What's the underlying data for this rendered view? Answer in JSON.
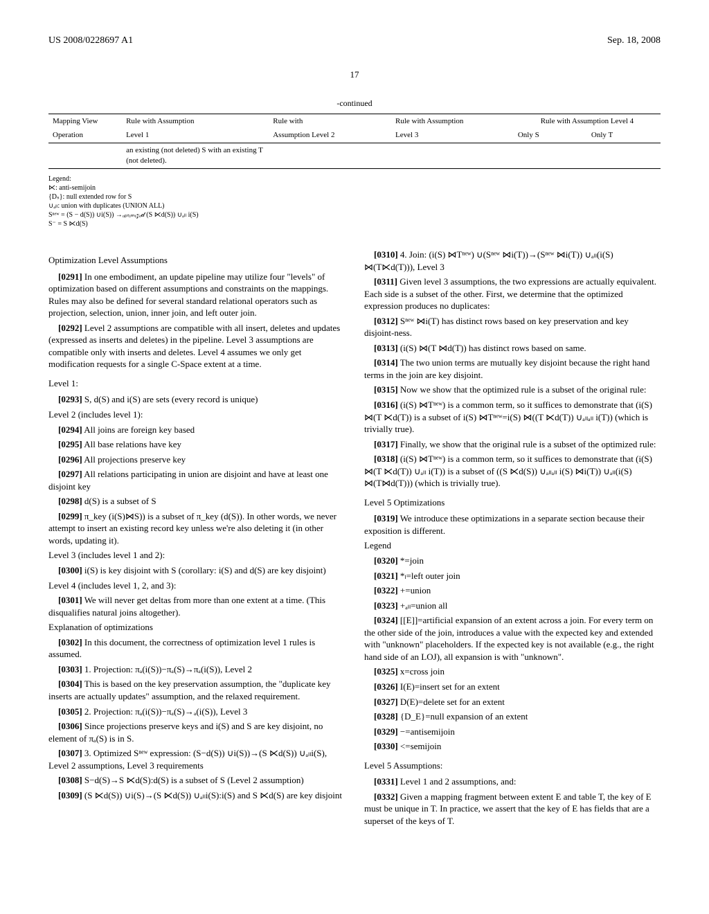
{
  "header": {
    "pub_no": "US 2008/0228697 A1",
    "date": "Sep. 18, 2008"
  },
  "page_number": "17",
  "table": {
    "caption": "-continued",
    "h_mapping_view": "Mapping View",
    "h_rule_assumption": "Rule with Assumption",
    "h_rule_with": "Rule with",
    "h_rule_assumption2": "Rule with Assumption",
    "h_rule_assumption_level4": "Rule with Assumption Level 4",
    "h_operation": "Operation",
    "h_level1": "Level 1",
    "h_assumption_level2": "Assumption Level 2",
    "h_level3": "Level 3",
    "h_only_s": "Only S",
    "h_only_t": "Only T",
    "cell_text": "an existing (not deleted) S with an existing T (not deleted)."
  },
  "legend": {
    "title": "Legend:",
    "l1": "⋉: anti-semijoin",
    "l2": "{Dₛ}: null extended row for S",
    "l3": "∪ₐₗₗ: union with duplicates (UNION ALL)",
    "l4": "Sⁿᵉʷ = (S − d(S)) ∪i(S)) →ₒₚₜᵢₘᵢ𝓏ₑ𝒹 (S ⋉d(S)) ∪ₐₗₗ i(S)",
    "l5": "S⁻ = S ⋉d(S)"
  },
  "left": {
    "opt_title": "Optimization Level Assumptions",
    "p0291n": "[0291]",
    "p0291": "In one embodiment, an update pipeline may utilize four \"levels\" of optimization based on different assumptions and constraints on the mappings. Rules may also be defined for several standard relational operators such as projection, selection, union, inner join, and left outer join.",
    "p0292n": "[0292]",
    "p0292": "Level 2 assumptions are compatible with all insert, deletes and updates (expressed as inserts and deletes) in the pipeline. Level 3 assumptions are compatible only with inserts and deletes. Level 4 assumes we only get modification requests for a single C-Space extent at a time.",
    "level1_title": "Level 1:",
    "p0293n": "[0293]",
    "p0293": "S, d(S) and i(S) are sets (every record is unique)",
    "level2_includes": "Level 2 (includes level 1):",
    "p0294n": "[0294]",
    "p0294": "All joins are foreign key based",
    "p0295n": "[0295]",
    "p0295": "All base relations have key",
    "p0296n": "[0296]",
    "p0296": "All projections preserve key",
    "p0297n": "[0297]",
    "p0297": "All relations participating in union are disjoint and have at least one disjoint key",
    "p0298n": "[0298]",
    "p0298": "d(S) is a subset of S",
    "p0299n": "[0299]",
    "p0299": "π_key (i(S)⋈S)) is a subset of π_key (d(S)). In other words, we never attempt to insert an existing record key unless we're also deleting it (in other words, updating it).",
    "level3_includes": "Level 3 (includes level 1 and 2):",
    "p0300n": "[0300]",
    "p0300": "i(S) is key disjoint with S (corollary: i(S) and d(S) are key disjoint)",
    "level4_includes": "Level 4 (includes level 1, 2, and 3):",
    "p0301n": "[0301]",
    "p0301": "We will never get deltas from more than one extent at a time. (This disqualifies natural joins altogether).",
    "explanation": "Explanation of optimizations",
    "p0302n": "[0302]",
    "p0302": "In this document, the correctness of optimization level 1 rules is assumed.",
    "p0303n": "[0303]",
    "p0303": "1. Projection: πₐ(i(S))−πₐ(S)→πₐ(i(S)), Level 2",
    "p0304n": "[0304]",
    "p0304": "This is based on the key preservation assumption, the \"duplicate key inserts are actually updates\" assumption, and the relaxed requirement.",
    "p0305n": "[0305]",
    "p0305": "2. Projection: πₐ(i(S))−πₐ(S)→ₐ(i(S)), Level 3",
    "p0306n": "[0306]",
    "p0306": "Since projections preserve keys and i(S) and S are key disjoint, no element of πₐ(S) is in S.",
    "p0307n": "[0307]",
    "p0307": "3. Optimized Sⁿᵉʷ expression: (S−d(S)) ∪i(S))→(S ⋉d(S)) ∪ₐₗₗi(S), Level 2 assumptions, Level 3 requirements",
    "p0308n": "[0308]",
    "p0308": "S−d(S)→S ⋉d(S):d(S) is a subset of S (Level 2 assumption)",
    "p0309n": "[0309]",
    "p0309": "(S ⋉d(S)) ∪i(S)→(S ⋉d(S)) ∪ₐₗₗi(S):i(S) and S ⋉d(S) are key disjoint"
  },
  "right": {
    "p0310n": "[0310]",
    "p0310": "4. Join: (i(S) ⋈Tⁿᵉʷ) ∪(Sⁿᵉʷ ⋈i(T))→(Sⁿᵉʷ ⋈i(T)) ∪ₐₗₗ(i(S) ⋈(T⋉d(T))), Level 3",
    "p0311n": "[0311]",
    "p0311": "Given level 3 assumptions, the two expressions are actually equivalent. Each side is a subset of the other. First, we determine that the optimized expression produces no duplicates:",
    "p0312n": "[0312]",
    "p0312": "Sⁿᵉʷ ⋈i(T) has distinct rows based on key preservation and key disjoint-ness.",
    "p0313n": "[0313]",
    "p0313": "(i(S) ⋈(T ⋈d(T)) has distinct rows based on same.",
    "p0314n": "[0314]",
    "p0314": "The two union terms are mutually key disjoint because the right hand terms in the join are key disjoint.",
    "p0315n": "[0315]",
    "p0315": "Now we show that the optimized rule is a subset of the original rule:",
    "p0316n": "[0316]",
    "p0316": "(i(S) ⋈Tⁿᵉʷ) is a common term, so it suffices to demonstrate that (i(S) ⋈(T ⋉d(T)) is a subset of i(S) ⋈Tⁿᵉʷ=i(S) ⋈((T ⋉d(T)) ∪ₐₗₗₐₗₗ i(T)) (which is trivially true).",
    "p0317n": "[0317]",
    "p0317": "Finally, we show that the original rule is a subset of the optimized rule:",
    "p0318n": "[0318]",
    "p0318": "(i(S) ⋈Tⁿᵉʷ) is a common term, so it suffices to demonstrate that (i(S) ⋈(T ⋉d(T)) ∪ₐₗₗ i(T)) is a subset of ((S ⋉d(S)) ∪ₐₗₗₐₗₗ i(S) ⋈i(T)) ∪ₐₗₗ(i(S) ⋈(T⋈d(T))) (which is trivially true).",
    "level5_opt": "Level 5 Optimizations",
    "p0319n": "[0319]",
    "p0319": "We introduce these optimizations in a separate section because their exposition is different.",
    "legend_title": "Legend",
    "p0320n": "[0320]",
    "p0320": "*=join",
    "p0321n": "[0321]",
    "p0321": "*ₗ=left outer join",
    "p0322n": "[0322]",
    "p0322": "+=union",
    "p0323n": "[0323]",
    "p0323": "+ₐₗₗ=union all",
    "p0324n": "[0324]",
    "p0324": "[[E]]=artificial expansion of an extent across a join. For every term on the other side of the join, introduces a value with the expected key and extended with \"unknown\" placeholders. If the expected key is not available (e.g., the right hand side of an LOJ), all expansion is with \"unknown\".",
    "p0325n": "[0325]",
    "p0325": "x=cross join",
    "p0326n": "[0326]",
    "p0326": "I(E)=insert set for an extent",
    "p0327n": "[0327]",
    "p0327": "D(E)=delete set for an extent",
    "p0328n": "[0328]",
    "p0328": "{D_E}=null expansion of an extent",
    "p0329n": "[0329]",
    "p0329": "−=antisemijoin",
    "p0330n": "[0330]",
    "p0330": "<=semijoin",
    "level5_assumptions": "Level 5 Assumptions:",
    "p0331n": "[0331]",
    "p0331": "Level 1 and 2 assumptions, and:",
    "p0332n": "[0332]",
    "p0332": "Given a mapping fragment between extent E and table T, the key of E must be unique in T. In practice, we assert that the key of E has fields that are a superset of the keys of T."
  }
}
